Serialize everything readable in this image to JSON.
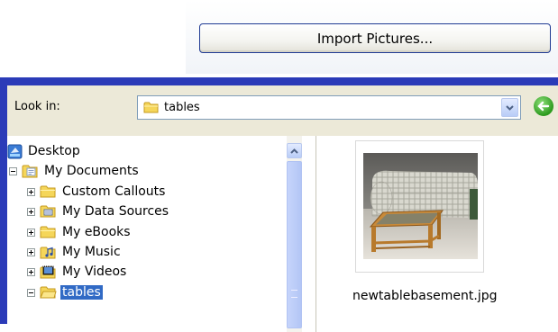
{
  "import_button": {
    "label": "Import Pictures..."
  },
  "dialog": {
    "look_in_label": "Look in:",
    "look_in_value": "tables",
    "tree": [
      {
        "label": "Desktop",
        "icon": "desktop-icon",
        "expander": "none",
        "indent": 0,
        "selected": false
      },
      {
        "label": "My Documents",
        "icon": "my-documents-icon",
        "expander": "minus",
        "indent": 0,
        "selected": false
      },
      {
        "label": "Custom Callouts",
        "icon": "folder-icon",
        "expander": "plus",
        "indent": 1,
        "selected": false
      },
      {
        "label": "My Data Sources",
        "icon": "data-sources-folder-icon",
        "expander": "plus",
        "indent": 1,
        "selected": false
      },
      {
        "label": "My eBooks",
        "icon": "folder-icon",
        "expander": "plus",
        "indent": 1,
        "selected": false
      },
      {
        "label": "My Music",
        "icon": "music-folder-icon",
        "expander": "plus",
        "indent": 1,
        "selected": false
      },
      {
        "label": "My Videos",
        "icon": "videos-folder-icon",
        "expander": "plus",
        "indent": 1,
        "selected": false
      },
      {
        "label": "tables",
        "icon": "folder-icon",
        "expander": "minus",
        "indent": 1,
        "selected": true
      }
    ],
    "preview": {
      "filename": "newtablebasement.jpg"
    }
  },
  "colors": {
    "dialog_border": "#2b3bb8",
    "dialog_face": "#ece9d8",
    "selection": "#316ac5",
    "folder_yellow": "#f5d65a"
  }
}
